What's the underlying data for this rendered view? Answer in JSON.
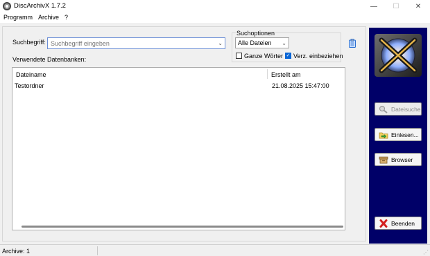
{
  "window": {
    "title": "DiscArchivX 1.7.2",
    "minimize_glyph": "—",
    "maximize_glyph": "☐",
    "close_glyph": "✕"
  },
  "menu": {
    "items": [
      "Programm",
      "Archive",
      "?"
    ]
  },
  "search": {
    "label": "Suchbegriff:",
    "placeholder": "Suchbegriff eingeben",
    "value": ""
  },
  "options": {
    "group_title": "Suchoptionen",
    "file_type": {
      "selected": "Alle Dateien",
      "options": [
        "Alle Dateien"
      ]
    },
    "whole_words": {
      "label": "Ganze Wörter",
      "checked": false
    },
    "include_dirs": {
      "label": "Verz. einbeziehen",
      "checked": true
    }
  },
  "databases": {
    "label": "Verwendete Datenbanken:",
    "columns": [
      "Dateiname",
      "Erstellt am"
    ],
    "rows": [
      {
        "name": "Testordner",
        "created": "21.08.2025 15:47:00"
      }
    ]
  },
  "side_buttons": {
    "search": {
      "label": "Dateisuche",
      "icon": "magnifier-icon",
      "enabled": false
    },
    "import": {
      "label": "Einlesen...",
      "icon": "folder-import-icon",
      "enabled": true
    },
    "browser": {
      "label": "Browser",
      "icon": "archive-box-icon",
      "enabled": true
    },
    "quit": {
      "label": "Beenden",
      "icon": "red-x-icon",
      "enabled": true
    }
  },
  "status": {
    "archives": "Archive: 1"
  },
  "colors": {
    "side_panel": "#000068",
    "accent": "#0a66d6"
  }
}
